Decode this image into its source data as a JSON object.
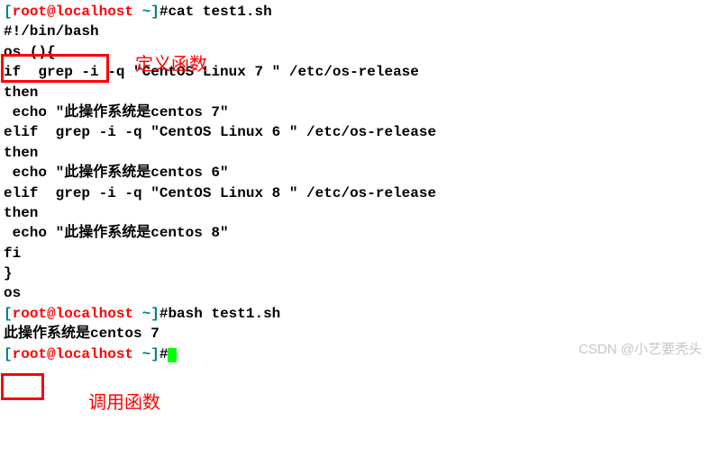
{
  "prompt": {
    "open_bracket": "[",
    "user_host": "root@localhost",
    "path": " ~",
    "close_bracket": "]",
    "hash": "#"
  },
  "commands": {
    "cat": "cat test1.sh",
    "bash": "bash test1.sh"
  },
  "script": {
    "shebang": "#!/bin/bash",
    "empty": "",
    "fn_def": "os (){",
    "if_line": "if  grep -i -q \"CentOS Linux 7 \" /etc/os-release",
    "then1": "then",
    "echo1": " echo \"此操作系统是centos 7\"",
    "blank": "",
    "elif1": "elif  grep -i -q \"CentOS Linux 6 \" /etc/os-release",
    "then2": "then",
    "echo2": " echo \"此操作系统是centos 6\"",
    "elif2": "elif  grep -i -q \"CentOS Linux 8 \" /etc/os-release",
    "then3": "then",
    "echo3": " echo \"此操作系统是centos 8\"",
    "fi": "fi",
    "close_brace": "}",
    "call": "os"
  },
  "output": {
    "result": "此操作系统是centos 7"
  },
  "annotations": {
    "define_fn": "定义函数",
    "call_fn": "调用函数"
  },
  "watermark": "CSDN @小艺要秃头"
}
